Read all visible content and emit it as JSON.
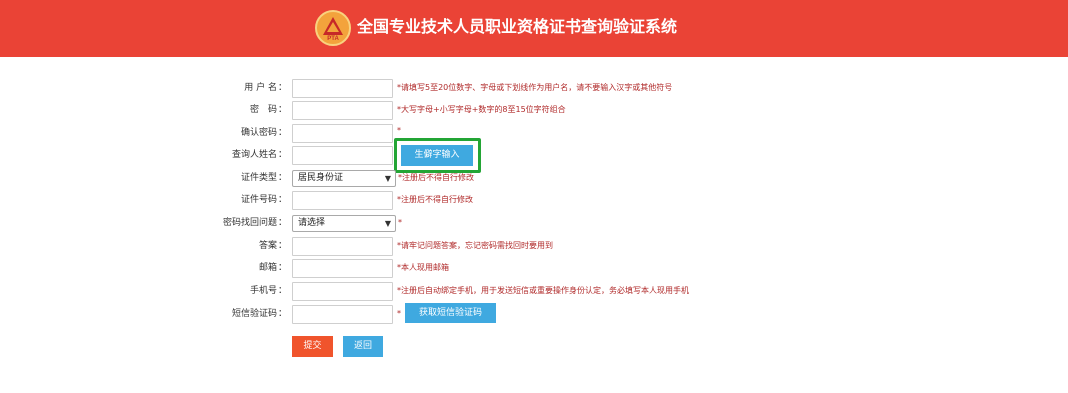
{
  "header": {
    "title": "全国专业技术人员职业资格证书查询验证系统",
    "logo_text": "PTA",
    "bg_color": "#ea4336"
  },
  "form": {
    "username": {
      "label": "用 户 名",
      "hint": "*请填写5至20位数字、字母或下划线作为用户名，请不要输入汉字或其他符号",
      "value": ""
    },
    "password": {
      "label": "密　码",
      "hint": "*大写字母+小写字母+数字的8至15位字符组合",
      "value": ""
    },
    "confirm_password": {
      "label": "确认密码",
      "hint": "*",
      "value": ""
    },
    "name": {
      "label": "查询人姓名",
      "value": "",
      "rare_char_button": "生僻字输入"
    },
    "id_type": {
      "label": "证件类型",
      "selected": "居民身份证",
      "hint": "*注册后不得自行修改"
    },
    "id_number": {
      "label": "证件号码",
      "hint": "*注册后不得自行修改",
      "value": ""
    },
    "security_question": {
      "label": "密码找回问题",
      "selected": "请选择",
      "hint": "*"
    },
    "answer": {
      "label": "答案",
      "hint": "*请牢记问题答案，忘记密码需找回时要用到",
      "value": ""
    },
    "email": {
      "label": "邮箱",
      "hint": "*本人现用邮箱",
      "value": ""
    },
    "phone": {
      "label": "手机号",
      "hint": "*注册后自动绑定手机，用于发送短信或重要操作身份认定，务必填写本人现用手机",
      "value": ""
    },
    "sms_code": {
      "label": "短信验证码",
      "hint": "*",
      "value": "",
      "get_code_button": "获取短信验证码"
    },
    "colon": "："
  },
  "actions": {
    "submit": "提交",
    "back": "返回"
  },
  "colors": {
    "accent_blue": "#3fa9e0",
    "submit_orange": "#f0542c",
    "highlight_green": "#23a535",
    "hint_red": "#b02a2a"
  }
}
